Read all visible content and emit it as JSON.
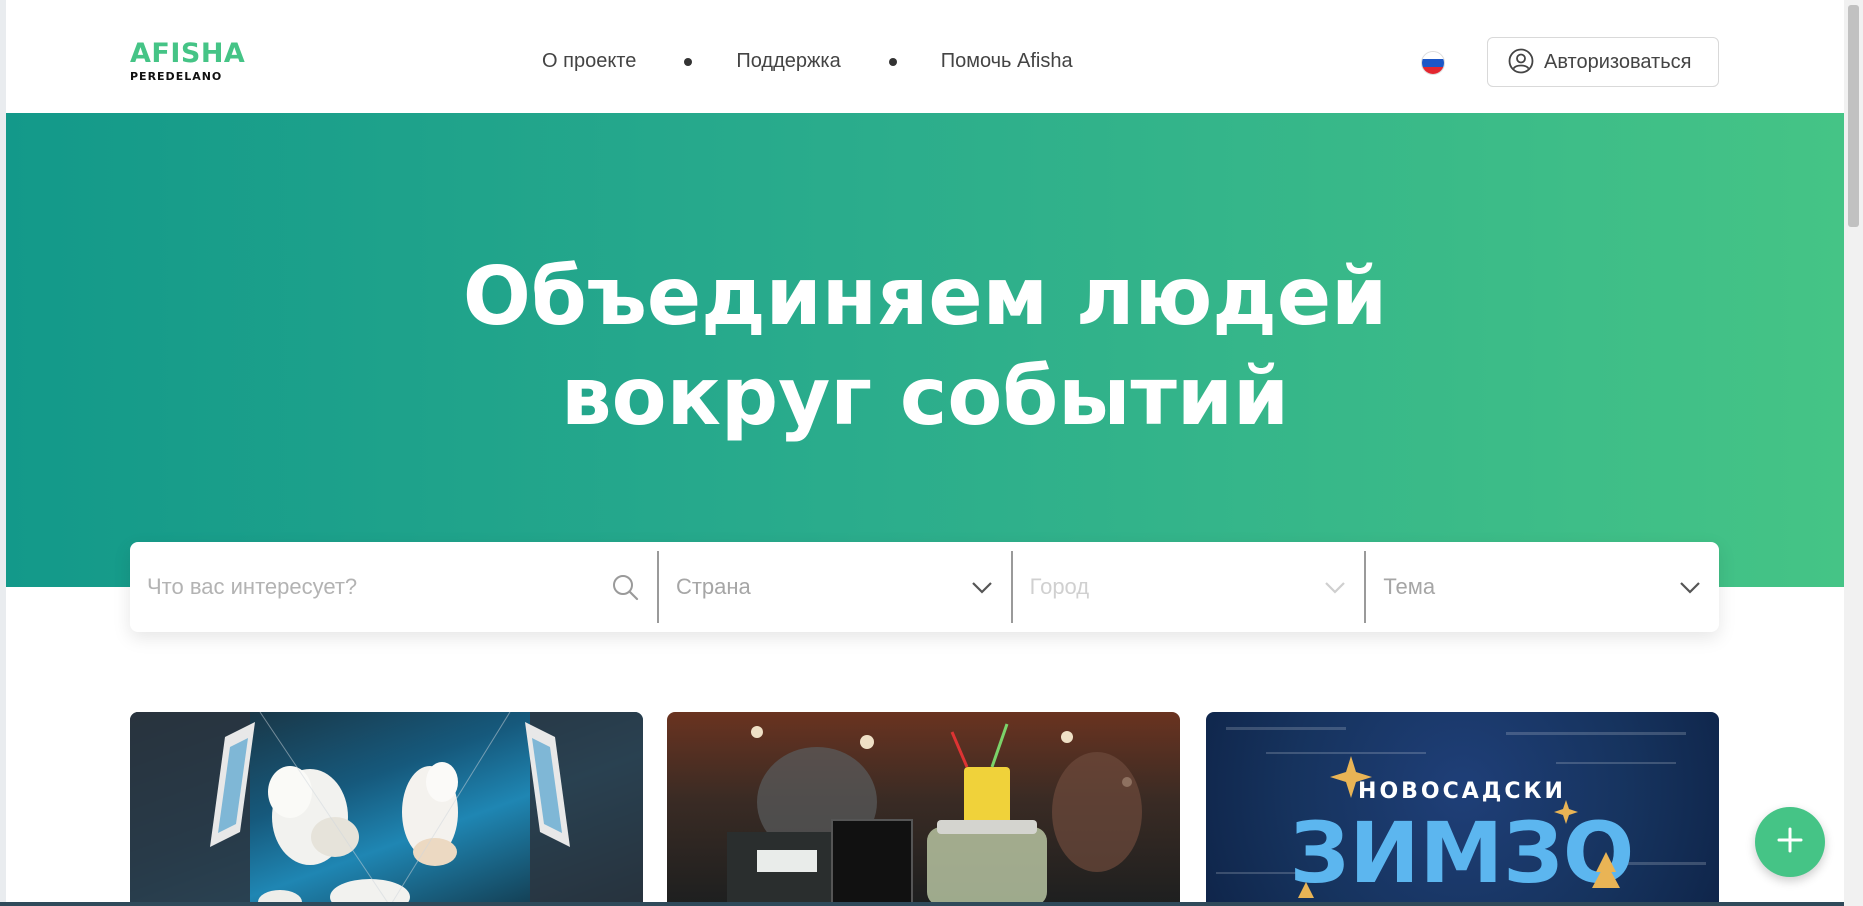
{
  "header": {
    "logo_top": "AFISHA",
    "logo_bottom": "PEREDELANO",
    "nav": [
      {
        "label": "О проекте"
      },
      {
        "label": "Поддержка"
      },
      {
        "label": "Помочь Afisha"
      }
    ],
    "language_icon": "russia-flag-icon",
    "auth_button": {
      "label": "Авторизоваться",
      "icon": "user-circle-icon"
    }
  },
  "hero": {
    "title_line1": "Объединяем людей",
    "title_line2": "вокруг событий"
  },
  "search": {
    "query_placeholder": "Что вас интересует?",
    "country_placeholder": "Страна",
    "city_placeholder": "Город",
    "topic_placeholder": "Тема"
  },
  "cards": [
    {
      "image": "art-installation-clouds"
    },
    {
      "image": "market-drink-jar"
    },
    {
      "image_text_top": "НОВОСАДСКИ",
      "image_text_main": "ЗИМЗО"
    }
  ],
  "colors": {
    "brand": "#45c486",
    "hero_gradient_start": "#13998a",
    "hero_gradient_end": "#45c486"
  },
  "fab": {
    "icon": "plus-icon"
  }
}
